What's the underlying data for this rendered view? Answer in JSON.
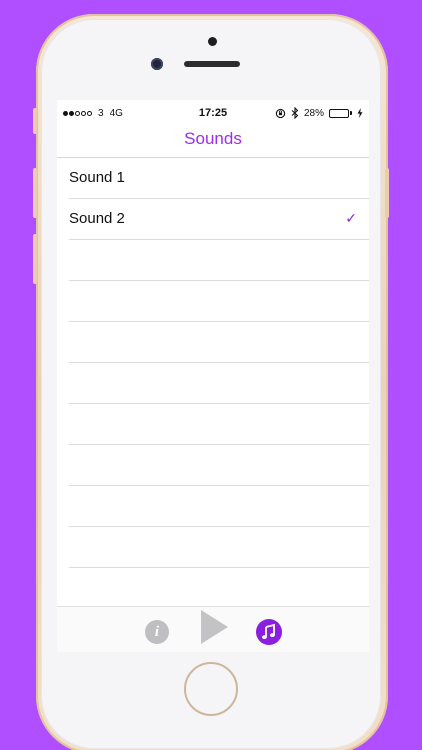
{
  "status_bar": {
    "carrier": "3",
    "network": "4G",
    "time": "17:25",
    "battery_percent": "28%",
    "battery_level": 0.28,
    "signal_bars_filled": 2,
    "signal_bars_total": 5
  },
  "nav": {
    "title": "Sounds"
  },
  "sounds": {
    "items": [
      {
        "label": "Sound 1",
        "selected": false
      },
      {
        "label": "Sound 2",
        "selected": true
      }
    ],
    "empty_row_count": 9,
    "check_glyph": "✓"
  },
  "toolbar": {
    "info_glyph": "i",
    "buttons": [
      "info-icon",
      "play-icon",
      "music-note-icon"
    ]
  },
  "colors": {
    "background": "#b04fff",
    "accent": "#9b2eea",
    "active_icon": "#8a1fe0",
    "inactive_icon": "#c3c3c6",
    "battery": "#4cd964"
  }
}
